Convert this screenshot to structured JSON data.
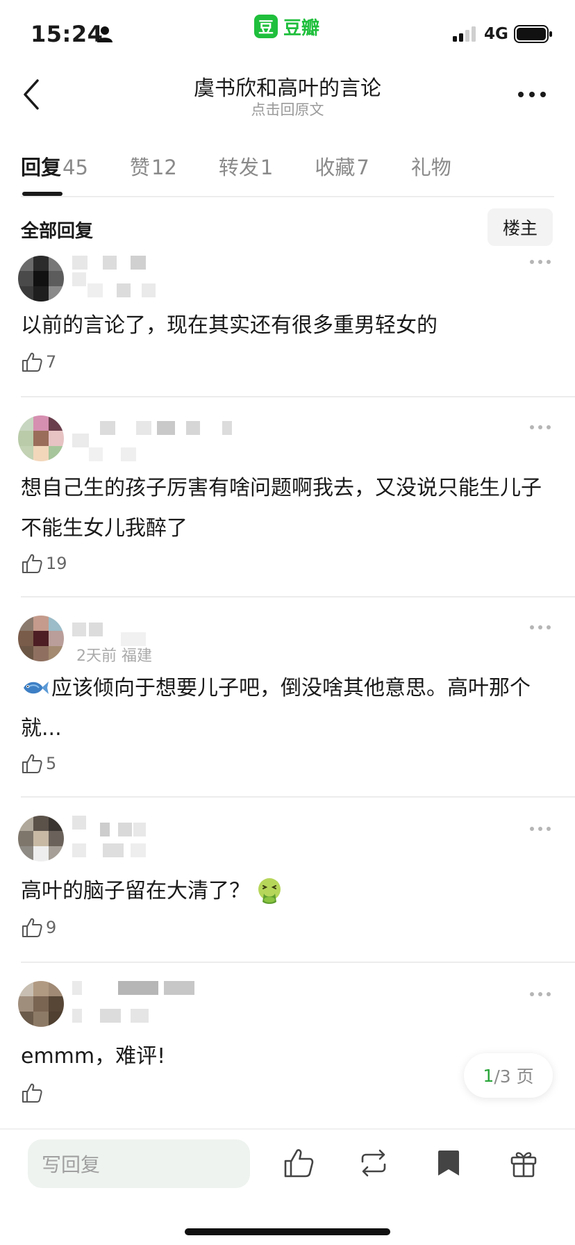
{
  "status_bar": {
    "time": "15:24",
    "app_logo": "豆",
    "app_name": "豆瓣",
    "network": "4G",
    "icons": [
      "person-icon",
      "signal-icon",
      "battery-icon"
    ]
  },
  "nav": {
    "title": "虞书欣和高叶的言论",
    "subtitle": "点击回原文",
    "icons": [
      "back-icon",
      "more-icon"
    ]
  },
  "tabs": [
    {
      "label": "回复",
      "count": "45",
      "active": true
    },
    {
      "label": "赞",
      "count": "12",
      "active": false
    },
    {
      "label": "转发",
      "count": "1",
      "active": false
    },
    {
      "label": "收藏",
      "count": "7",
      "active": false
    },
    {
      "label": "礼物",
      "count": "",
      "active": false
    }
  ],
  "section": {
    "title": "全部回复",
    "op_button": "楼主"
  },
  "comments": [
    {
      "meta": "",
      "text": "以前的言论了，现在其实还有很多重男轻女的",
      "likes": "7"
    },
    {
      "meta": "",
      "text": "想自己生的孩子厉害有啥问题啊我去，又没说只能生儿子不能生女儿我醉了",
      "likes": "19"
    },
    {
      "meta": "2天前 福建",
      "text": "应该倾向于想要儿子吧，倒没啥其他意思。高叶那个就...",
      "likes": "5",
      "emoji": "fish-icon"
    },
    {
      "meta": "",
      "text": "高叶的脑子留在大清了？",
      "likes": "9",
      "emoji": "nauseated-face-icon"
    },
    {
      "meta": "",
      "text": "emmm，难评!",
      "likes": ""
    }
  ],
  "pagination": {
    "current": "1",
    "rest": "/3 页"
  },
  "bottom_bar": {
    "reply_placeholder": "写回复",
    "icons": [
      "like-icon",
      "repost-icon",
      "bookmark-icon",
      "gift-icon"
    ]
  },
  "colors": {
    "brand": "#1fbf3c",
    "page_current": "#2aa53a",
    "input_bg": "#eef3ef"
  }
}
